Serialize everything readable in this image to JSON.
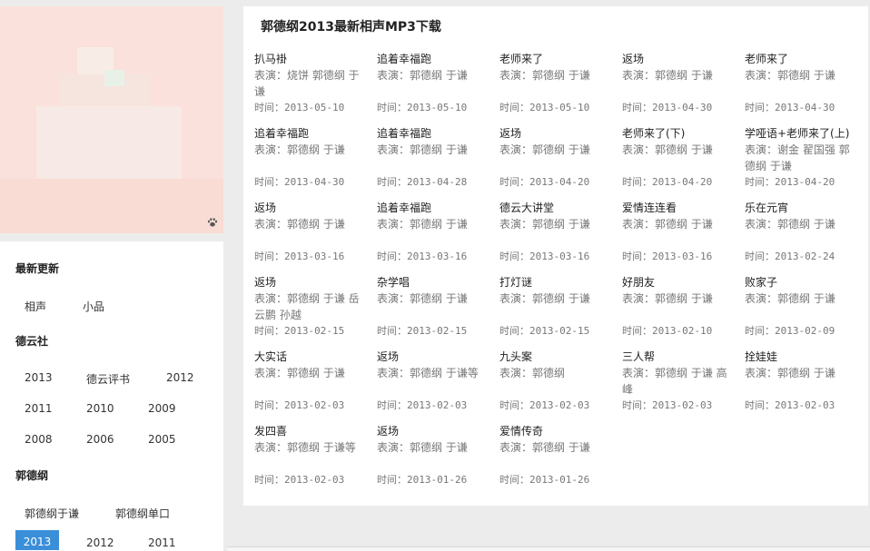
{
  "main": {
    "title": "郭德纲2013最新相声MP3下载",
    "performer_prefix": "表演：",
    "time_prefix": "时间：",
    "items": [
      {
        "title": "扒马褂",
        "performers": "烧饼 郭德纲 于谦",
        "date": "2013-05-10"
      },
      {
        "title": "追着幸福跑",
        "performers": "郭德纲 于谦",
        "date": "2013-05-10"
      },
      {
        "title": "老师来了",
        "performers": "郭德纲 于谦",
        "date": "2013-05-10"
      },
      {
        "title": "返场",
        "performers": "郭德纲 于谦",
        "date": "2013-04-30"
      },
      {
        "title": "老师来了",
        "performers": "郭德纲 于谦",
        "date": "2013-04-30"
      },
      {
        "title": "追着幸福跑",
        "performers": "郭德纲 于谦",
        "date": "2013-04-30"
      },
      {
        "title": "追着幸福跑",
        "performers": "郭德纲 于谦",
        "date": "2013-04-28"
      },
      {
        "title": "返场",
        "performers": "郭德纲 于谦",
        "date": "2013-04-20"
      },
      {
        "title": "老师来了(下)",
        "performers": "郭德纲 于谦",
        "date": "2013-04-20"
      },
      {
        "title": "学哑语+老师来了(上)",
        "performers": "谢金 翟国强 郭德纲 于谦",
        "date": "2013-04-20"
      },
      {
        "title": "返场",
        "performers": "郭德纲 于谦",
        "date": "2013-03-16"
      },
      {
        "title": "追着幸福跑",
        "performers": "郭德纲 于谦",
        "date": "2013-03-16"
      },
      {
        "title": "德云大讲堂",
        "performers": "郭德纲 于谦",
        "date": "2013-03-16"
      },
      {
        "title": "爱情连连看",
        "performers": "郭德纲 于谦",
        "date": "2013-03-16"
      },
      {
        "title": "乐在元宵",
        "performers": "郭德纲 于谦",
        "date": "2013-02-24"
      },
      {
        "title": "返场",
        "performers": "郭德纲 于谦 岳云鹏 孙越",
        "date": "2013-02-15"
      },
      {
        "title": "杂学唱",
        "performers": "郭德纲 于谦",
        "date": "2013-02-15"
      },
      {
        "title": "打灯谜",
        "performers": "郭德纲 于谦",
        "date": "2013-02-15"
      },
      {
        "title": "好朋友",
        "performers": "郭德纲 于谦",
        "date": "2013-02-10"
      },
      {
        "title": "败家子",
        "performers": "郭德纲 于谦",
        "date": "2013-02-09"
      },
      {
        "title": "大实话",
        "performers": "郭德纲 于谦",
        "date": "2013-02-03"
      },
      {
        "title": "返场",
        "performers": "郭德纲 于谦等",
        "date": "2013-02-03"
      },
      {
        "title": "九头案",
        "performers": "郭德纲",
        "date": "2013-02-03"
      },
      {
        "title": "三人帮",
        "performers": "郭德纲 于谦 高峰",
        "date": "2013-02-03"
      },
      {
        "title": "拴娃娃",
        "performers": "郭德纲 于谦",
        "date": "2013-02-03"
      },
      {
        "title": "发四喜",
        "performers": "郭德纲 于谦等",
        "date": "2013-02-03"
      },
      {
        "title": "返场",
        "performers": "郭德纲 于谦",
        "date": "2013-01-26"
      },
      {
        "title": "爱情传奇",
        "performers": "郭德纲 于谦",
        "date": "2013-01-26"
      }
    ]
  },
  "sidebar": {
    "latest_heading": "最新更新",
    "latest_links": [
      "相声",
      "小品"
    ],
    "deyun_heading": "德云社",
    "deyun_links": [
      "2013",
      "德云评书",
      "2012",
      "2011",
      "2010",
      "2009",
      "2008",
      "2006",
      "2005"
    ],
    "guo_heading": "郭德纲",
    "guo_links": [
      "郭德纲于谦",
      "郭德纲单口"
    ],
    "year_links": [
      "2013",
      "2012",
      "2011"
    ],
    "active_year": "2013"
  },
  "icons": {
    "paw": "paw-icon"
  },
  "colors": {
    "active_tab": "#3b8fd9",
    "placeholder_bg": "#fbe1db"
  }
}
